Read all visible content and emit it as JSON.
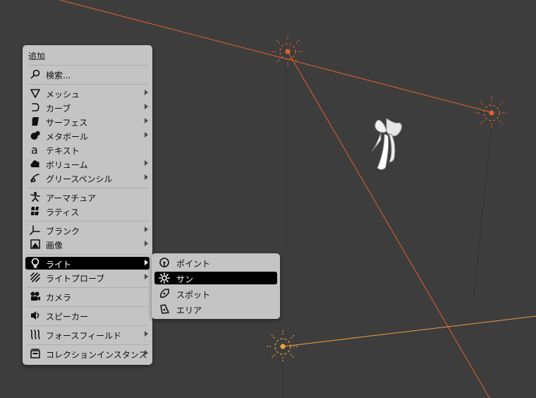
{
  "add_menu": {
    "title": "追加",
    "items": [
      {
        "label": "検索...",
        "icon": "search-icon",
        "submenu": false
      },
      {
        "label": "メッシュ",
        "icon": "mesh-icon",
        "submenu": true
      },
      {
        "label": "カーブ",
        "icon": "curve-icon",
        "submenu": true
      },
      {
        "label": "サーフェス",
        "icon": "surface-icon",
        "submenu": true
      },
      {
        "label": "メタボール",
        "icon": "metaball-icon",
        "submenu": true
      },
      {
        "label": "テキスト",
        "icon": "text-icon",
        "submenu": false
      },
      {
        "label": "ボリューム",
        "icon": "volume-icon",
        "submenu": true
      },
      {
        "label": "グリースペンシル",
        "icon": "grease-pencil-icon",
        "submenu": true
      },
      {
        "label": "アーマチュア",
        "icon": "armature-icon",
        "submenu": false
      },
      {
        "label": "ラティス",
        "icon": "lattice-icon",
        "submenu": false
      },
      {
        "label": "ブランク",
        "icon": "empty-icon",
        "submenu": true
      },
      {
        "label": "画像",
        "icon": "image-icon",
        "submenu": true
      },
      {
        "label": "ライト",
        "icon": "light-bulb-icon",
        "submenu": true,
        "active": true
      },
      {
        "label": "ライトプローブ",
        "icon": "light-probe-icon",
        "submenu": true
      },
      {
        "label": "カメラ",
        "icon": "camera-icon",
        "submenu": false
      },
      {
        "label": "スピーカー",
        "icon": "speaker-icon",
        "submenu": false
      },
      {
        "label": "フォースフィールド",
        "icon": "force-field-icon",
        "submenu": true
      },
      {
        "label": "コレクションインスタンス",
        "icon": "collection-instance-icon",
        "submenu": true
      }
    ]
  },
  "light_submenu": {
    "items": [
      {
        "label": "ポイント",
        "icon": "point-light-icon"
      },
      {
        "label": "サン",
        "icon": "sun-light-icon",
        "active": true
      },
      {
        "label": "スポット",
        "icon": "spot-light-icon"
      },
      {
        "label": "エリア",
        "icon": "area-light-icon"
      }
    ]
  },
  "colors": {
    "viewport_bg": "#3d3d3d",
    "menu_bg": "#c4c4c4",
    "highlight_bg": "#000000",
    "selected_light": "#e0622a",
    "active_light": "#f0a040"
  }
}
